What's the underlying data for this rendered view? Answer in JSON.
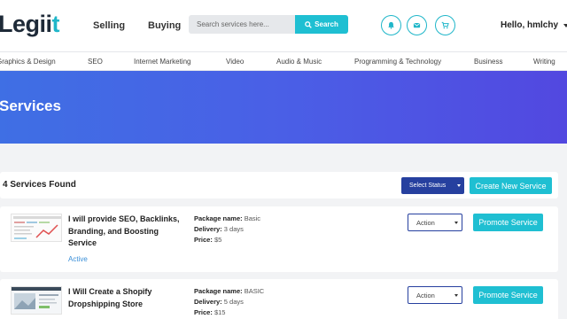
{
  "header": {
    "logo_main": "Legii",
    "logo_accent": "t",
    "nav": [
      {
        "label": "Selling"
      },
      {
        "label": "Buying"
      }
    ],
    "search": {
      "placeholder": "Search services here...",
      "value": "",
      "button_label": "Search"
    },
    "icons": [
      "bell-icon",
      "mail-icon",
      "cart-icon"
    ],
    "user_label": "Hello, hmlchy"
  },
  "categories": [
    {
      "label": "Graphics & Design"
    },
    {
      "label": "SEO"
    },
    {
      "label": "Internet Marketing"
    },
    {
      "label": "Video"
    },
    {
      "label": "Audio & Music"
    },
    {
      "label": "Programming & Technology"
    },
    {
      "label": "Business"
    },
    {
      "label": "Writing"
    }
  ],
  "banner": {
    "title": "Services"
  },
  "toolbar": {
    "found_text": "4 Services Found",
    "status_select": "Select Status",
    "create_label": "Create New Service"
  },
  "services": [
    {
      "title": "I will provide SEO, Backlinks, Branding, and Boosting Service",
      "status": "Active",
      "package_label": "Package name:",
      "package_value": "Basic",
      "delivery_label": "Delivery:",
      "delivery_value": "3 days",
      "price_label": "Price:",
      "price_value": "$5",
      "action_label": "Action",
      "promote_label": "Promote Service"
    },
    {
      "title": "I Will Create a Shopify Dropshipping Store",
      "status": "",
      "package_label": "Package name:",
      "package_value": "BASIC",
      "delivery_label": "Delivery:",
      "delivery_value": "5 days",
      "price_label": "Price:",
      "price_value": "$15",
      "action_label": "Action",
      "promote_label": "Promote Service"
    }
  ],
  "colors": {
    "accent": "#1fbfd2",
    "primary_dark": "#26409f",
    "banner_start": "#3f6fe4",
    "banner_end": "#5248e0",
    "status_active": "#3a8fd8"
  }
}
